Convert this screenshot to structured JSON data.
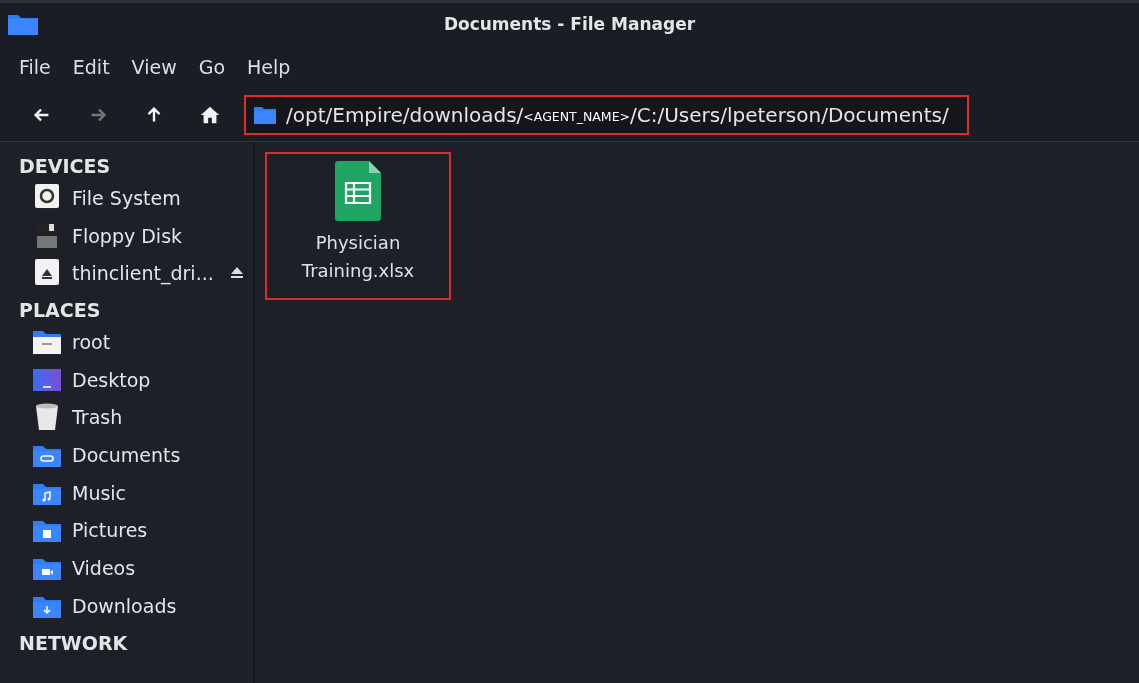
{
  "window": {
    "title": "Documents - File Manager"
  },
  "menu": [
    "File",
    "Edit",
    "View",
    "Go",
    "Help"
  ],
  "toolbar": [
    {
      "kind": "back",
      "disabled": false
    },
    {
      "kind": "forward",
      "disabled": true
    },
    {
      "kind": "up",
      "disabled": false
    },
    {
      "kind": "home",
      "disabled": false
    }
  ],
  "location": {
    "parts": [
      {
        "text": "/opt/Empire/downloads/",
        "kind": "path"
      },
      {
        "text": "<AGENT_NAME>",
        "kind": "placeholder"
      },
      {
        "text": "/C:/Users/lpeterson/Documents/",
        "kind": "path"
      }
    ],
    "highlighted": true
  },
  "sidebar": [
    {
      "heading": "DEVICES",
      "items": [
        {
          "label": "File System",
          "kind": "drive",
          "ejectable": false
        },
        {
          "label": "Floppy Disk",
          "kind": "floppy",
          "ejectable": false
        },
        {
          "label": "thinclient_dri...",
          "kind": "usb",
          "ejectable": true
        }
      ]
    },
    {
      "heading": "PLACES",
      "items": [
        {
          "label": "root",
          "kind": "home",
          "ejectable": false
        },
        {
          "label": "Desktop",
          "kind": "desktop",
          "ejectable": false
        },
        {
          "label": "Trash",
          "kind": "trash",
          "ejectable": false
        },
        {
          "label": "Documents",
          "kind": "documents",
          "ejectable": false
        },
        {
          "label": "Music",
          "kind": "music",
          "ejectable": false
        },
        {
          "label": "Pictures",
          "kind": "pictures",
          "ejectable": false
        },
        {
          "label": "Videos",
          "kind": "videos",
          "ejectable": false
        },
        {
          "label": "Downloads",
          "kind": "downloads",
          "ejectable": false
        }
      ]
    },
    {
      "heading": "NETWORK"
    }
  ],
  "files": [
    {
      "name": "Physician Training.xlsx",
      "kind": "spreadsheet",
      "highlighted": true
    }
  ]
}
